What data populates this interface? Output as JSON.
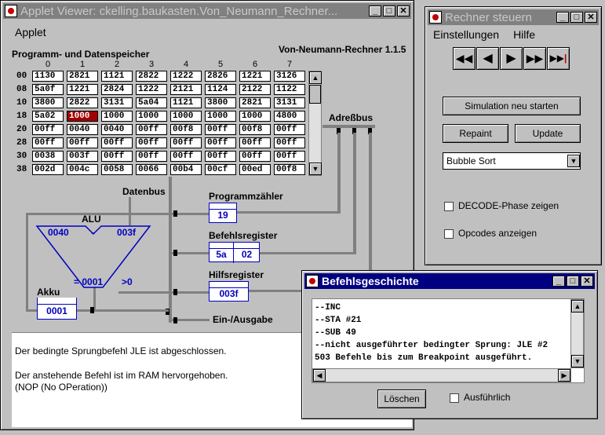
{
  "applet_window": {
    "title": "Applet Viewer: ckelling.baukasten.Von_Neumann_Rechner...",
    "menu": [
      "Applet"
    ],
    "heading": "Programm- und Datenspeicher",
    "version": "Von-Neumann-Rechner 1.1.5",
    "memory": {
      "columns": [
        "0",
        "1",
        "2",
        "3",
        "4",
        "5",
        "6",
        "7"
      ],
      "rows": [
        {
          "addr": "00",
          "cells": [
            "1130",
            "2821",
            "1121",
            "2822",
            "1222",
            "2826",
            "1221",
            "3126"
          ]
        },
        {
          "addr": "08",
          "cells": [
            "5a0f",
            "1221",
            "2824",
            "1222",
            "2121",
            "1124",
            "2122",
            "1122"
          ]
        },
        {
          "addr": "10",
          "cells": [
            "3800",
            "2822",
            "3131",
            "5a04",
            "1121",
            "3800",
            "2821",
            "3131"
          ]
        },
        {
          "addr": "18",
          "cells": [
            "5a02",
            "1000",
            "1000",
            "1000",
            "1000",
            "1000",
            "1000",
            "4800"
          ]
        },
        {
          "addr": "20",
          "cells": [
            "00ff",
            "0040",
            "0040",
            "00ff",
            "00f8",
            "00ff",
            "00f8",
            "00ff"
          ]
        },
        {
          "addr": "28",
          "cells": [
            "00ff",
            "00ff",
            "00ff",
            "00ff",
            "00ff",
            "00ff",
            "00ff",
            "00ff"
          ]
        },
        {
          "addr": "30",
          "cells": [
            "0038",
            "003f",
            "00ff",
            "00ff",
            "00ff",
            "00ff",
            "00ff",
            "00ff"
          ]
        },
        {
          "addr": "38",
          "cells": [
            "002d",
            "004c",
            "0058",
            "0066",
            "00b4",
            "00cf",
            "00ed",
            "00f8"
          ]
        }
      ],
      "highlighted": {
        "row": 3,
        "col": 1
      }
    },
    "labels": {
      "adressbus": "Adreßbus",
      "datenbus": "Datenbus",
      "alu": "ALU",
      "akku": "Akku",
      "programmzaehler": "Programmzähler",
      "befehlsregister": "Befehlsregister",
      "hilfsregister": "Hilfsregister",
      "ein_ausgabe": "Ein-/Ausgabe"
    },
    "alu": {
      "left": "0040",
      "op": "-",
      "right": "003f",
      "result": "= 0001",
      "flag": ">0"
    },
    "registers": {
      "akku": "0001",
      "pc": "19",
      "ir_op": "5a",
      "ir_arg": "02",
      "hilf": "003f"
    },
    "status_lines": [
      "Der bedingte Sprungbefehl JLE ist abgeschlossen.",
      "",
      "Der anstehende Befehl ist im RAM hervorgehoben.",
      "(NOP (No OPeration))"
    ]
  },
  "control_window": {
    "title": "Rechner steuern",
    "menu": [
      "Einstellungen",
      "Hilfe"
    ],
    "media_buttons": [
      "rewind-icon",
      "step-back-icon",
      "play-icon",
      "fast-forward-icon",
      "skip-to-end-icon"
    ],
    "restart_label": "Simulation neu starten",
    "repaint_label": "Repaint",
    "update_label": "Update",
    "program_select": "Bubble Sort",
    "decode_label": "DECODE-Phase zeigen",
    "opcodes_label": "Opcodes anzeigen"
  },
  "history_window": {
    "title": "Befehlsgeschichte",
    "lines": [
      "--INC",
      "--STA #21",
      "--SUB 49",
      "--nicht ausgeführter bedingter Sprung: JLE #2",
      "503 Befehle bis zum Breakpoint ausgeführt."
    ],
    "clear_label": "Löschen",
    "verbose_label": "Ausführlich"
  }
}
